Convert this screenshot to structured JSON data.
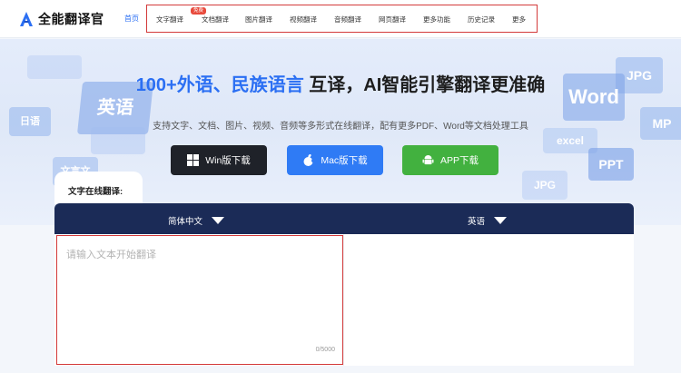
{
  "app": {
    "name": "全能翻译官",
    "accent": "#2b6ff3"
  },
  "nav": {
    "home": "首页",
    "items": [
      {
        "label": "文字翻译",
        "badge": "免费"
      },
      {
        "label": "文档翻译"
      },
      {
        "label": "图片翻译"
      },
      {
        "label": "视频翻译"
      },
      {
        "label": "音频翻译"
      },
      {
        "label": "网页翻译"
      },
      {
        "label": "更多功能"
      },
      {
        "label": "历史记录"
      },
      {
        "label": "更多"
      }
    ]
  },
  "hero": {
    "title_highlight": "100+外语、民族语言",
    "title_rest": " 互译，AI智能引擎翻译更准确",
    "subtitle": "支持文字、文档、图片、视频、音频等多形式在线翻译，配有更多PDF、Word等文档处理工具",
    "decor": {
      "english": "英语",
      "japanese": "日语",
      "classical": "文言文",
      "word": "Word",
      "jpg": "JPG",
      "mp": "MP",
      "ppt": "PPT",
      "excel": "excel",
      "jpg2": "JPG"
    }
  },
  "downloads": {
    "win": {
      "label": "Win版下载",
      "color": "#1f2229",
      "icon": "windows-icon"
    },
    "mac": {
      "label": "Mac版下载",
      "color": "#2f7bf5",
      "icon": "apple-icon"
    },
    "app": {
      "label": "APP下载",
      "color": "#42b13f",
      "icon": "android-icon"
    }
  },
  "translator": {
    "tab_label": "文字在线翻译:",
    "source_lang": "简体中文",
    "target_lang": "英语",
    "input_placeholder": "请输入文本开始翻译",
    "char_counter": "0/5000"
  }
}
